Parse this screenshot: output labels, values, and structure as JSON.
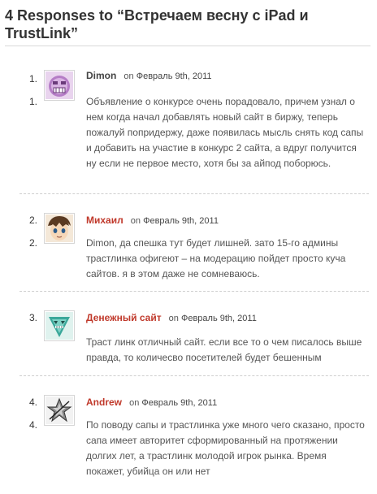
{
  "heading": "4 Responses to “Встречаем весну с iPad и TrustLink”",
  "comments": [
    {
      "number": "1.",
      "author": "Dimon",
      "on": "on",
      "date": "Февраль 9th, 2011",
      "text": "Объявление о конкурсе очень порадовало, причем узнал о нем когда начал добавлять новый сайт в биржу, теперь пожалуй попридержу, даже появилась мысль снять код сапы и добавить на участие в конкурс 2 сайта, а вдруг получится ну если не первое место, хотя бы за айпод поборюсь.",
      "avatar_icon": "purple-robot-face-icon"
    },
    {
      "number": "2.",
      "author": "Михаил",
      "on": "on",
      "date": "Февраль 9th, 2011",
      "text": "Dimon, да спешка тут будет лишней. зато 15-го админы трастлинка офигеют – на модерацию пойдет просто куча сайтов. я в этом даже не сомневаюсь.",
      "avatar_icon": "anime-boy-face-icon"
    },
    {
      "number": "3.",
      "author": "Денежный сайт",
      "on": "on",
      "date": "Февраль 9th, 2011",
      "text": "Траст линк отличный сайт. если все то о чем писалось выше правда, то количесво посетителей будет бешенным",
      "avatar_icon": "triangle-monster-icon"
    },
    {
      "number": "4.",
      "author": "Andrew",
      "on": "on",
      "date": "Февраль 9th, 2011",
      "text": "По поводу сапы и трастлинка уже много чего сказано, просто сапа имеет авторитет сформированный на протяжении долгих лет, а трастлинк молодой игрок рынка. Время покажет, убийца он или нет",
      "avatar_icon": "metallic-star-icon"
    }
  ],
  "colors": {
    "author_link": "#c0392b",
    "author_plain": "#444444",
    "separator": "#cfcfcf"
  }
}
